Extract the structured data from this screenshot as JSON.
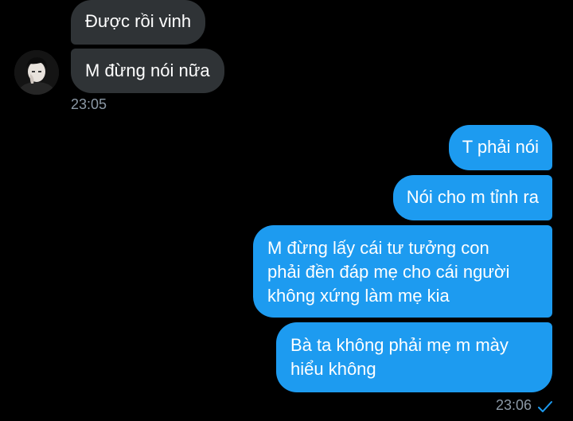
{
  "received": {
    "messages": [
      {
        "text": "Được rồi vinh"
      },
      {
        "text": "M đừng nói nữa"
      }
    ],
    "timestamp": "23:05"
  },
  "sent": {
    "messages": [
      {
        "text": "T phải nói"
      },
      {
        "text": "Nói cho m tỉnh ra"
      },
      {
        "text": "M đừng lấy cái tư tưởng con\nphải đền đáp mẹ cho cái người\nkhông xứng làm mẹ kia"
      },
      {
        "text": "Bà ta không phải mẹ m mày\nhiểu không"
      }
    ],
    "timestamp": "23:06",
    "status_icon": "read-check-icon"
  },
  "colors": {
    "background": "#000000",
    "received_bubble": "#2f3336",
    "sent_bubble": "#1d9bf0",
    "timestamp": "#8b98a5"
  }
}
